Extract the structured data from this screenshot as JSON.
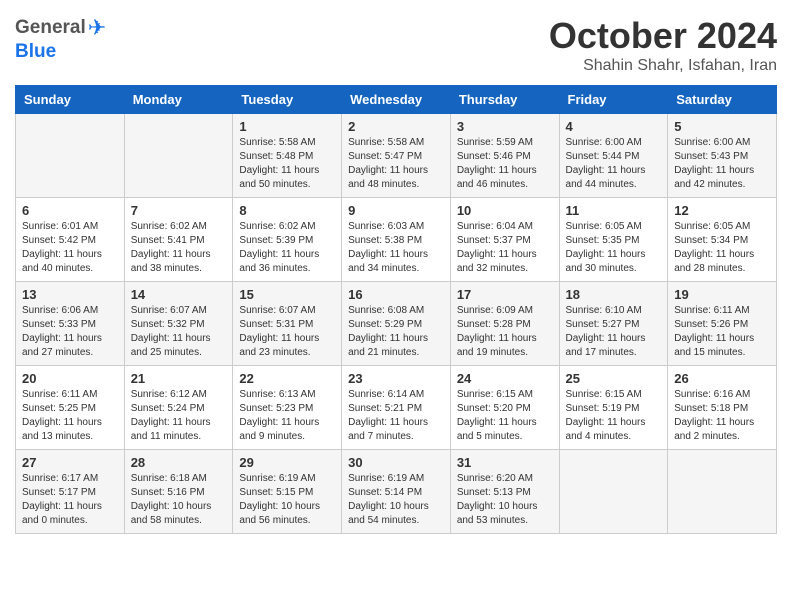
{
  "header": {
    "logo_general": "General",
    "logo_blue": "Blue",
    "month_title": "October 2024",
    "location": "Shahin Shahr, Isfahan, Iran"
  },
  "days_of_week": [
    "Sunday",
    "Monday",
    "Tuesday",
    "Wednesday",
    "Thursday",
    "Friday",
    "Saturday"
  ],
  "weeks": [
    [
      {
        "day": "",
        "info": ""
      },
      {
        "day": "",
        "info": ""
      },
      {
        "day": "1",
        "info": "Sunrise: 5:58 AM\nSunset: 5:48 PM\nDaylight: 11 hours and 50 minutes."
      },
      {
        "day": "2",
        "info": "Sunrise: 5:58 AM\nSunset: 5:47 PM\nDaylight: 11 hours and 48 minutes."
      },
      {
        "day": "3",
        "info": "Sunrise: 5:59 AM\nSunset: 5:46 PM\nDaylight: 11 hours and 46 minutes."
      },
      {
        "day": "4",
        "info": "Sunrise: 6:00 AM\nSunset: 5:44 PM\nDaylight: 11 hours and 44 minutes."
      },
      {
        "day": "5",
        "info": "Sunrise: 6:00 AM\nSunset: 5:43 PM\nDaylight: 11 hours and 42 minutes."
      }
    ],
    [
      {
        "day": "6",
        "info": "Sunrise: 6:01 AM\nSunset: 5:42 PM\nDaylight: 11 hours and 40 minutes."
      },
      {
        "day": "7",
        "info": "Sunrise: 6:02 AM\nSunset: 5:41 PM\nDaylight: 11 hours and 38 minutes."
      },
      {
        "day": "8",
        "info": "Sunrise: 6:02 AM\nSunset: 5:39 PM\nDaylight: 11 hours and 36 minutes."
      },
      {
        "day": "9",
        "info": "Sunrise: 6:03 AM\nSunset: 5:38 PM\nDaylight: 11 hours and 34 minutes."
      },
      {
        "day": "10",
        "info": "Sunrise: 6:04 AM\nSunset: 5:37 PM\nDaylight: 11 hours and 32 minutes."
      },
      {
        "day": "11",
        "info": "Sunrise: 6:05 AM\nSunset: 5:35 PM\nDaylight: 11 hours and 30 minutes."
      },
      {
        "day": "12",
        "info": "Sunrise: 6:05 AM\nSunset: 5:34 PM\nDaylight: 11 hours and 28 minutes."
      }
    ],
    [
      {
        "day": "13",
        "info": "Sunrise: 6:06 AM\nSunset: 5:33 PM\nDaylight: 11 hours and 27 minutes."
      },
      {
        "day": "14",
        "info": "Sunrise: 6:07 AM\nSunset: 5:32 PM\nDaylight: 11 hours and 25 minutes."
      },
      {
        "day": "15",
        "info": "Sunrise: 6:07 AM\nSunset: 5:31 PM\nDaylight: 11 hours and 23 minutes."
      },
      {
        "day": "16",
        "info": "Sunrise: 6:08 AM\nSunset: 5:29 PM\nDaylight: 11 hours and 21 minutes."
      },
      {
        "day": "17",
        "info": "Sunrise: 6:09 AM\nSunset: 5:28 PM\nDaylight: 11 hours and 19 minutes."
      },
      {
        "day": "18",
        "info": "Sunrise: 6:10 AM\nSunset: 5:27 PM\nDaylight: 11 hours and 17 minutes."
      },
      {
        "day": "19",
        "info": "Sunrise: 6:11 AM\nSunset: 5:26 PM\nDaylight: 11 hours and 15 minutes."
      }
    ],
    [
      {
        "day": "20",
        "info": "Sunrise: 6:11 AM\nSunset: 5:25 PM\nDaylight: 11 hours and 13 minutes."
      },
      {
        "day": "21",
        "info": "Sunrise: 6:12 AM\nSunset: 5:24 PM\nDaylight: 11 hours and 11 minutes."
      },
      {
        "day": "22",
        "info": "Sunrise: 6:13 AM\nSunset: 5:23 PM\nDaylight: 11 hours and 9 minutes."
      },
      {
        "day": "23",
        "info": "Sunrise: 6:14 AM\nSunset: 5:21 PM\nDaylight: 11 hours and 7 minutes."
      },
      {
        "day": "24",
        "info": "Sunrise: 6:15 AM\nSunset: 5:20 PM\nDaylight: 11 hours and 5 minutes."
      },
      {
        "day": "25",
        "info": "Sunrise: 6:15 AM\nSunset: 5:19 PM\nDaylight: 11 hours and 4 minutes."
      },
      {
        "day": "26",
        "info": "Sunrise: 6:16 AM\nSunset: 5:18 PM\nDaylight: 11 hours and 2 minutes."
      }
    ],
    [
      {
        "day": "27",
        "info": "Sunrise: 6:17 AM\nSunset: 5:17 PM\nDaylight: 11 hours and 0 minutes."
      },
      {
        "day": "28",
        "info": "Sunrise: 6:18 AM\nSunset: 5:16 PM\nDaylight: 10 hours and 58 minutes."
      },
      {
        "day": "29",
        "info": "Sunrise: 6:19 AM\nSunset: 5:15 PM\nDaylight: 10 hours and 56 minutes."
      },
      {
        "day": "30",
        "info": "Sunrise: 6:19 AM\nSunset: 5:14 PM\nDaylight: 10 hours and 54 minutes."
      },
      {
        "day": "31",
        "info": "Sunrise: 6:20 AM\nSunset: 5:13 PM\nDaylight: 10 hours and 53 minutes."
      },
      {
        "day": "",
        "info": ""
      },
      {
        "day": "",
        "info": ""
      }
    ]
  ]
}
